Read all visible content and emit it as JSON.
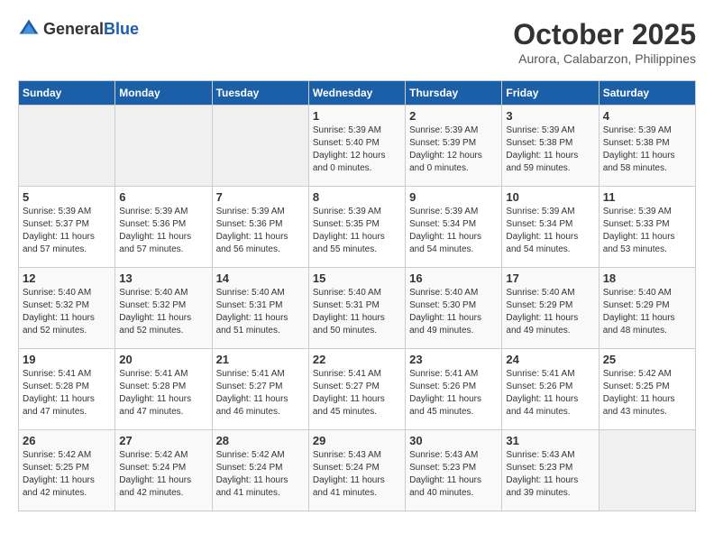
{
  "header": {
    "logo": {
      "general": "General",
      "blue": "Blue"
    },
    "month": "October 2025",
    "location": "Aurora, Calabarzon, Philippines"
  },
  "weekdays": [
    "Sunday",
    "Monday",
    "Tuesday",
    "Wednesday",
    "Thursday",
    "Friday",
    "Saturday"
  ],
  "weeks": [
    [
      {
        "day": "",
        "sunrise": "",
        "sunset": "",
        "daylight": "",
        "empty": true
      },
      {
        "day": "",
        "sunrise": "",
        "sunset": "",
        "daylight": "",
        "empty": true
      },
      {
        "day": "",
        "sunrise": "",
        "sunset": "",
        "daylight": "",
        "empty": true
      },
      {
        "day": "1",
        "sunrise": "Sunrise: 5:39 AM",
        "sunset": "Sunset: 5:40 PM",
        "daylight": "Daylight: 12 hours and 0 minutes."
      },
      {
        "day": "2",
        "sunrise": "Sunrise: 5:39 AM",
        "sunset": "Sunset: 5:39 PM",
        "daylight": "Daylight: 12 hours and 0 minutes."
      },
      {
        "day": "3",
        "sunrise": "Sunrise: 5:39 AM",
        "sunset": "Sunset: 5:38 PM",
        "daylight": "Daylight: 11 hours and 59 minutes."
      },
      {
        "day": "4",
        "sunrise": "Sunrise: 5:39 AM",
        "sunset": "Sunset: 5:38 PM",
        "daylight": "Daylight: 11 hours and 58 minutes."
      }
    ],
    [
      {
        "day": "5",
        "sunrise": "Sunrise: 5:39 AM",
        "sunset": "Sunset: 5:37 PM",
        "daylight": "Daylight: 11 hours and 57 minutes."
      },
      {
        "day": "6",
        "sunrise": "Sunrise: 5:39 AM",
        "sunset": "Sunset: 5:36 PM",
        "daylight": "Daylight: 11 hours and 57 minutes."
      },
      {
        "day": "7",
        "sunrise": "Sunrise: 5:39 AM",
        "sunset": "Sunset: 5:36 PM",
        "daylight": "Daylight: 11 hours and 56 minutes."
      },
      {
        "day": "8",
        "sunrise": "Sunrise: 5:39 AM",
        "sunset": "Sunset: 5:35 PM",
        "daylight": "Daylight: 11 hours and 55 minutes."
      },
      {
        "day": "9",
        "sunrise": "Sunrise: 5:39 AM",
        "sunset": "Sunset: 5:34 PM",
        "daylight": "Daylight: 11 hours and 54 minutes."
      },
      {
        "day": "10",
        "sunrise": "Sunrise: 5:39 AM",
        "sunset": "Sunset: 5:34 PM",
        "daylight": "Daylight: 11 hours and 54 minutes."
      },
      {
        "day": "11",
        "sunrise": "Sunrise: 5:39 AM",
        "sunset": "Sunset: 5:33 PM",
        "daylight": "Daylight: 11 hours and 53 minutes."
      }
    ],
    [
      {
        "day": "12",
        "sunrise": "Sunrise: 5:40 AM",
        "sunset": "Sunset: 5:32 PM",
        "daylight": "Daylight: 11 hours and 52 minutes."
      },
      {
        "day": "13",
        "sunrise": "Sunrise: 5:40 AM",
        "sunset": "Sunset: 5:32 PM",
        "daylight": "Daylight: 11 hours and 52 minutes."
      },
      {
        "day": "14",
        "sunrise": "Sunrise: 5:40 AM",
        "sunset": "Sunset: 5:31 PM",
        "daylight": "Daylight: 11 hours and 51 minutes."
      },
      {
        "day": "15",
        "sunrise": "Sunrise: 5:40 AM",
        "sunset": "Sunset: 5:31 PM",
        "daylight": "Daylight: 11 hours and 50 minutes."
      },
      {
        "day": "16",
        "sunrise": "Sunrise: 5:40 AM",
        "sunset": "Sunset: 5:30 PM",
        "daylight": "Daylight: 11 hours and 49 minutes."
      },
      {
        "day": "17",
        "sunrise": "Sunrise: 5:40 AM",
        "sunset": "Sunset: 5:29 PM",
        "daylight": "Daylight: 11 hours and 49 minutes."
      },
      {
        "day": "18",
        "sunrise": "Sunrise: 5:40 AM",
        "sunset": "Sunset: 5:29 PM",
        "daylight": "Daylight: 11 hours and 48 minutes."
      }
    ],
    [
      {
        "day": "19",
        "sunrise": "Sunrise: 5:41 AM",
        "sunset": "Sunset: 5:28 PM",
        "daylight": "Daylight: 11 hours and 47 minutes."
      },
      {
        "day": "20",
        "sunrise": "Sunrise: 5:41 AM",
        "sunset": "Sunset: 5:28 PM",
        "daylight": "Daylight: 11 hours and 47 minutes."
      },
      {
        "day": "21",
        "sunrise": "Sunrise: 5:41 AM",
        "sunset": "Sunset: 5:27 PM",
        "daylight": "Daylight: 11 hours and 46 minutes."
      },
      {
        "day": "22",
        "sunrise": "Sunrise: 5:41 AM",
        "sunset": "Sunset: 5:27 PM",
        "daylight": "Daylight: 11 hours and 45 minutes."
      },
      {
        "day": "23",
        "sunrise": "Sunrise: 5:41 AM",
        "sunset": "Sunset: 5:26 PM",
        "daylight": "Daylight: 11 hours and 45 minutes."
      },
      {
        "day": "24",
        "sunrise": "Sunrise: 5:41 AM",
        "sunset": "Sunset: 5:26 PM",
        "daylight": "Daylight: 11 hours and 44 minutes."
      },
      {
        "day": "25",
        "sunrise": "Sunrise: 5:42 AM",
        "sunset": "Sunset: 5:25 PM",
        "daylight": "Daylight: 11 hours and 43 minutes."
      }
    ],
    [
      {
        "day": "26",
        "sunrise": "Sunrise: 5:42 AM",
        "sunset": "Sunset: 5:25 PM",
        "daylight": "Daylight: 11 hours and 42 minutes."
      },
      {
        "day": "27",
        "sunrise": "Sunrise: 5:42 AM",
        "sunset": "Sunset: 5:24 PM",
        "daylight": "Daylight: 11 hours and 42 minutes."
      },
      {
        "day": "28",
        "sunrise": "Sunrise: 5:42 AM",
        "sunset": "Sunset: 5:24 PM",
        "daylight": "Daylight: 11 hours and 41 minutes."
      },
      {
        "day": "29",
        "sunrise": "Sunrise: 5:43 AM",
        "sunset": "Sunset: 5:24 PM",
        "daylight": "Daylight: 11 hours and 41 minutes."
      },
      {
        "day": "30",
        "sunrise": "Sunrise: 5:43 AM",
        "sunset": "Sunset: 5:23 PM",
        "daylight": "Daylight: 11 hours and 40 minutes."
      },
      {
        "day": "31",
        "sunrise": "Sunrise: 5:43 AM",
        "sunset": "Sunset: 5:23 PM",
        "daylight": "Daylight: 11 hours and 39 minutes."
      },
      {
        "day": "",
        "sunrise": "",
        "sunset": "",
        "daylight": "",
        "empty": true
      }
    ]
  ]
}
